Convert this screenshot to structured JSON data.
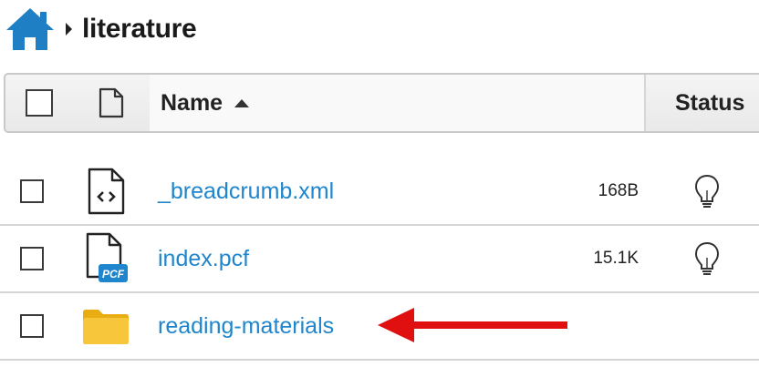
{
  "breadcrumb": {
    "home_icon": "home-icon",
    "current": "literature"
  },
  "table": {
    "header": {
      "name_label": "Name",
      "status_label": "Status",
      "sort": "ascending"
    },
    "rows": [
      {
        "name": "_breadcrumb.xml",
        "size": "168B",
        "icon": "xml-file-icon",
        "status_icon": "lightbulb-icon"
      },
      {
        "name": "index.pcf",
        "size": "15.1K",
        "icon": "pcf-file-icon",
        "icon_badge": "PCF",
        "status_icon": "lightbulb-icon"
      },
      {
        "name": "reading-materials",
        "size": "",
        "icon": "folder-icon",
        "status_icon": ""
      }
    ]
  },
  "colors": {
    "link": "#1f85cc",
    "home_icon": "#1f7fc4",
    "folder": "#f6c12e",
    "arrow": "#e01010",
    "pcf_badge": "#1f85cc"
  },
  "annotation": {
    "arrow_icon": "red-arrow-annotation"
  }
}
